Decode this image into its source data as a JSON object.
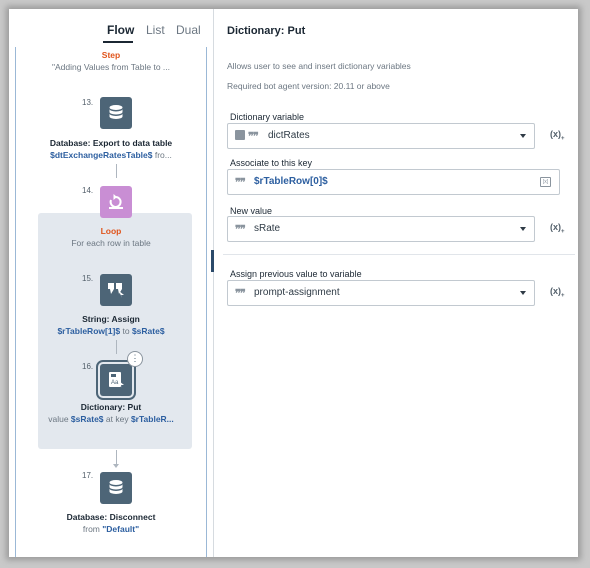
{
  "tabs": [
    {
      "label": "Flow"
    },
    {
      "label": "List"
    },
    {
      "label": "Dual"
    }
  ],
  "flow": {
    "step_header": {
      "kind": "Step",
      "title": "\"Adding Values from Table to ..."
    },
    "nodes": [
      {
        "num": "13.",
        "title": "Database: Export to data table",
        "detail_var": "$dtExchangeRatesTable$",
        "detail_rest": " fro..."
      },
      {
        "num": "14.",
        "title": "Loop",
        "detail": "For each row in table"
      },
      {
        "num": "15.",
        "title": "String: Assign",
        "var1": "$rTableRow[1]$",
        "mid": " to ",
        "var2": "$sRate$"
      },
      {
        "num": "16.",
        "title": "Dictionary: Put",
        "pre": "value ",
        "var1": "$sRate$",
        "mid": " at key ",
        "var2": "$rTableR..."
      },
      {
        "num": "17.",
        "title": "Database: Disconnect",
        "pre": "from ",
        "value": "\"Default\""
      }
    ],
    "more_glyph": "⋮"
  },
  "props": {
    "title": "Dictionary: Put",
    "description": "Allows user to see and insert dictionary variables",
    "required_version": "Required bot agent version: 20.11 or above",
    "fields": {
      "dictionary_variable": {
        "label": "Dictionary variable",
        "value": "dictRates"
      },
      "associate_key": {
        "label": "Associate to this key",
        "value": "$rTableRow[0]$"
      },
      "new_value": {
        "label": "New value",
        "value": "sRate"
      },
      "assign_previous": {
        "label": "Assign previous value to variable",
        "value": "prompt-assignment"
      }
    },
    "quote_glyph": "❞❞",
    "fx_label": "(x)",
    "var_icon_label": "[x]"
  },
  "colors": {
    "accent_step": "#e0541b",
    "node_dark": "#4d6577",
    "node_loop": "#c98ed4",
    "var_blue": "#2d5fa0"
  }
}
